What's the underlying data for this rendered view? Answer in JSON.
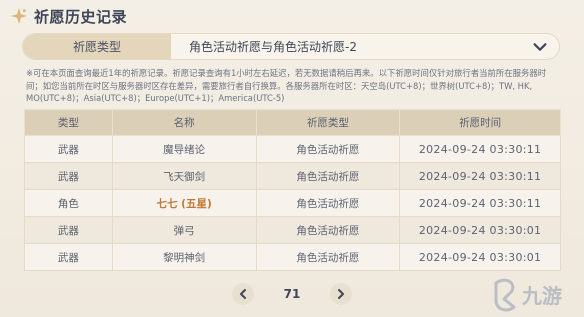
{
  "header": {
    "title": "祈愿历史记录",
    "icon": "sparkle-star-icon"
  },
  "filter": {
    "label": "祈愿类型",
    "value": "角色活动祈愿与角色活动祈愿-2"
  },
  "notice": "※可在本页面查询最近1年的祈愿记录。祈愿记录查询有1小时左右延迟，若无数据请稍后再来。以下祈愿时间仅针对旅行者当前所在服务器时间；如您当前所在时区与服务器时区存在差异，需要旅行者自行换算。各服务器所在时区：天空岛(UTC+8)；世界树(UTC+8)；TW, HK, MO(UTC+8)；Asia(UTC+8)；Europe(UTC+1)；America(UTC-5)",
  "table": {
    "headers": [
      "类型",
      "名称",
      "祈愿类型",
      "祈愿时间"
    ],
    "rows": [
      {
        "type": "武器",
        "name": "魔导绪论",
        "wish": "角色活动祈愿",
        "time": "2024-09-24 03:30:11"
      },
      {
        "type": "武器",
        "name": "飞天御剑",
        "wish": "角色活动祈愿",
        "time": "2024-09-24 03:30:11"
      },
      {
        "type": "角色",
        "name": "七七 (五星)",
        "wish": "角色活动祈愿",
        "time": "2024-09-24 03:30:11"
      },
      {
        "type": "武器",
        "name": "弹弓",
        "wish": "角色活动祈愿",
        "time": "2024-09-24 03:30:01"
      },
      {
        "type": "武器",
        "name": "黎明神剑",
        "wish": "角色活动祈愿",
        "time": "2024-09-24 03:30:01"
      }
    ]
  },
  "pager": {
    "page": "71"
  },
  "watermark": {
    "text": "九游"
  },
  "colors": {
    "accent": "#c07834",
    "header_bg": "#dccfb8",
    "label_bg": "#e3d6bb"
  }
}
